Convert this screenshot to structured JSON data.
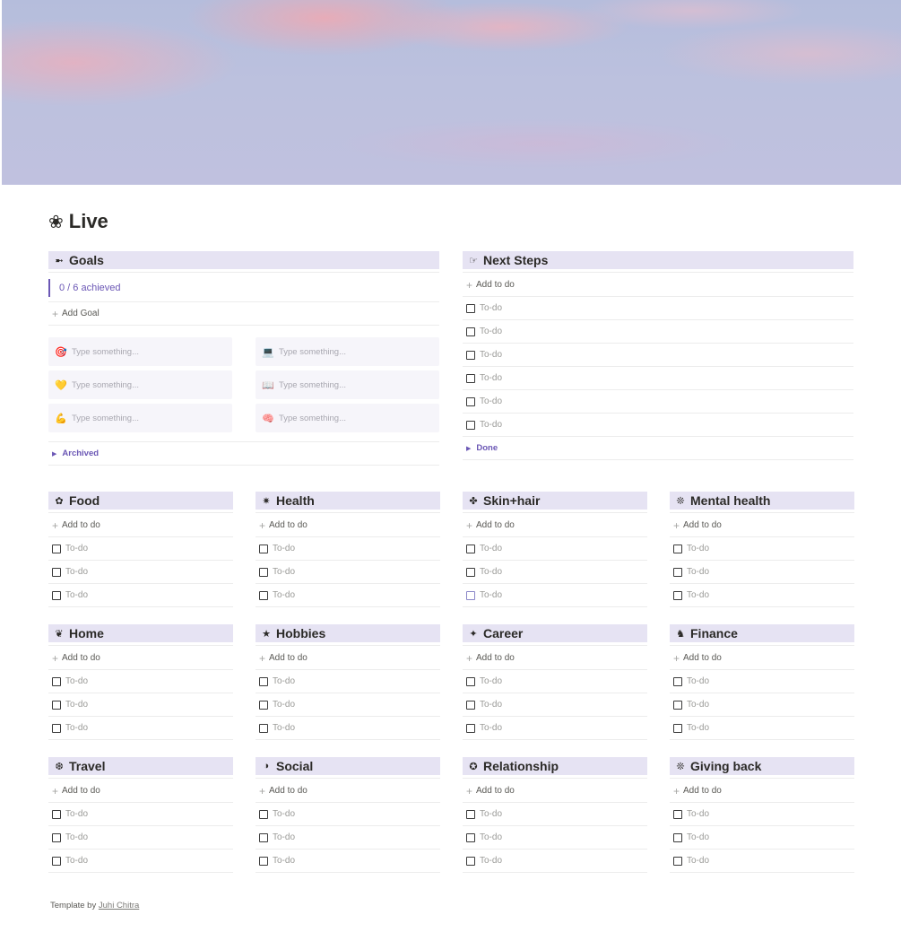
{
  "page": {
    "title": "Live",
    "title_icon": "flower-icon"
  },
  "goals": {
    "header": "Goals",
    "header_icon": "arrow-icon",
    "progress": "0 / 6 achieved",
    "add_label": "Add Goal",
    "placeholder": "Type something...",
    "cards": [
      {
        "icon": "🎯",
        "icon_name": "target-icon"
      },
      {
        "icon": "💻",
        "icon_name": "laptop-icon"
      },
      {
        "icon": "💛",
        "icon_name": "yellow-heart-icon"
      },
      {
        "icon": "📖",
        "icon_name": "book-icon"
      },
      {
        "icon": "💪",
        "icon_name": "flexed-biceps-icon"
      },
      {
        "icon": "🧠",
        "icon_name": "brain-icon"
      }
    ],
    "archived_label": "Archived"
  },
  "next_steps": {
    "header": "Next Steps",
    "header_icon": "pointing-hand-icon",
    "add_label": "Add to do",
    "todo_placeholder": "To-do",
    "todo_count": 6,
    "done_label": "Done"
  },
  "categories": {
    "add_label": "Add to do",
    "todo_placeholder": "To-do",
    "items": [
      {
        "name": "Food",
        "icon": "✿"
      },
      {
        "name": "Health",
        "icon": "✷"
      },
      {
        "name": "Skin+hair",
        "icon": "✤"
      },
      {
        "name": "Mental health",
        "icon": "❊"
      },
      {
        "name": "Home",
        "icon": "❦"
      },
      {
        "name": "Hobbies",
        "icon": "★"
      },
      {
        "name": "Career",
        "icon": "✦"
      },
      {
        "name": "Finance",
        "icon": "♞"
      },
      {
        "name": "Travel",
        "icon": "❆"
      },
      {
        "name": "Social",
        "icon": "◑"
      },
      {
        "name": "Relationship",
        "icon": "✪"
      },
      {
        "name": "Giving back",
        "icon": "❊"
      }
    ]
  },
  "footer": {
    "prefix": "Template by",
    "author": "Juhi Chitra"
  },
  "colors": {
    "header_bg": "#e6e3f3",
    "accent": "#6b57b5"
  }
}
